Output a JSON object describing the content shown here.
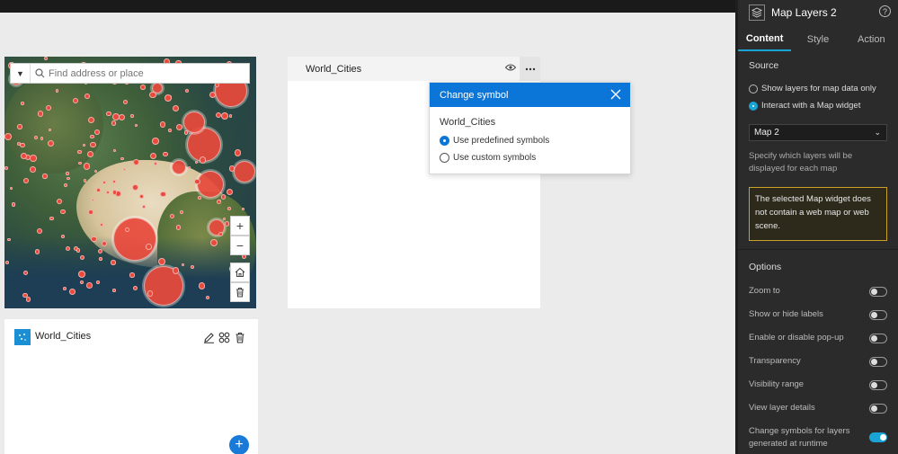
{
  "map": {
    "search_placeholder": "Find address or place",
    "zoom_in": "+",
    "zoom_out": "−"
  },
  "layer_list": {
    "layer_name": "World_Cities",
    "add_label": "+"
  },
  "widget_card": {
    "title": "World_Cities"
  },
  "change_symbol_popup": {
    "title": "Change symbol",
    "layer_name": "World_Cities",
    "options": [
      {
        "label": "Use predefined symbols",
        "selected": true
      },
      {
        "label": "Use custom symbols",
        "selected": false
      }
    ]
  },
  "settings_panel": {
    "title": "Map Layers 2",
    "help": "?",
    "tabs": [
      {
        "label": "Content",
        "active": true
      },
      {
        "label": "Style",
        "active": false
      },
      {
        "label": "Action",
        "active": false
      }
    ],
    "source": {
      "heading": "Source",
      "options": [
        {
          "label": "Show layers for map data only",
          "selected": false
        },
        {
          "label": "Interact with a Map widget",
          "selected": true
        }
      ],
      "map_select_value": "Map 2",
      "hint": "Specify which layers will be displayed for each map",
      "warning": "The selected Map widget does not contain a web map or web scene."
    },
    "options": {
      "heading": "Options",
      "items": [
        {
          "label": "Zoom to",
          "on": false
        },
        {
          "label": "Show or hide labels",
          "on": false
        },
        {
          "label": "Enable or disable pop-up",
          "on": false
        },
        {
          "label": "Transparency",
          "on": false
        },
        {
          "label": "Visibility range",
          "on": false
        },
        {
          "label": "View layer details",
          "on": false
        },
        {
          "label": "Change symbols for layers generated at runtime",
          "on": true
        }
      ]
    }
  },
  "colors": {
    "accent_blue": "#0b76d8",
    "toggle_on": "#1aa4d6",
    "city_marker": "#e94a3c",
    "warning_border": "#c9a227"
  }
}
